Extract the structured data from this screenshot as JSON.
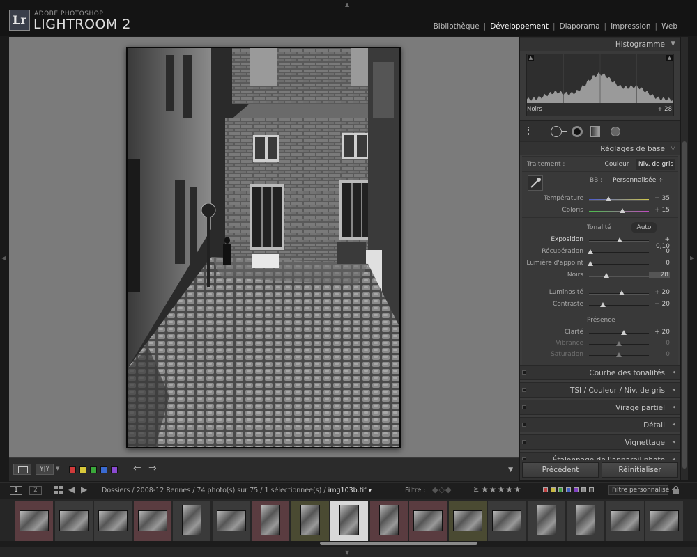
{
  "app": {
    "brand_top": "ADOBE PHOTOSHOP",
    "brand_main": "LIGHTROOM 2",
    "logo_text": "Lr"
  },
  "modules": [
    {
      "label": "Bibliothèque",
      "active": false
    },
    {
      "label": "Développement",
      "active": true
    },
    {
      "label": "Diaporama",
      "active": false
    },
    {
      "label": "Impression",
      "active": false
    },
    {
      "label": "Web",
      "active": false
    }
  ],
  "panels": {
    "histogram": {
      "title": "Histogramme",
      "left_label": "Noirs",
      "right_value": "+ 28"
    },
    "basic": {
      "title": "Réglages de base",
      "treatment_label": "Traitement :",
      "treatment_color": "Couleur",
      "treatment_gray": "Niv. de gris",
      "wb_label": "BB :",
      "wb_value": "Personnalisée ÷",
      "sliders_wb": [
        {
          "label": "Température",
          "value": "− 35",
          "pos": 0.32
        },
        {
          "label": "Coloris",
          "value": "+ 15",
          "pos": 0.56
        }
      ],
      "tone_label": "Tonalité",
      "auto_label": "Auto",
      "sliders_tone": [
        {
          "label": "Exposition",
          "value": "+ 0,10",
          "pos": 0.51,
          "bright": true
        },
        {
          "label": "Récupération",
          "value": "0",
          "pos": 0.0
        },
        {
          "label": "Lumière d'appoint",
          "value": "0",
          "pos": 0.0
        },
        {
          "label": "Noirs",
          "value": "28",
          "pos": 0.28
        }
      ],
      "sliders_tone2": [
        {
          "label": "Luminosité",
          "value": "+ 20",
          "pos": 0.55
        },
        {
          "label": "Contraste",
          "value": "− 20",
          "pos": 0.22
        }
      ],
      "presence_label": "Présence",
      "sliders_presence": [
        {
          "label": "Clarté",
          "value": "+ 20",
          "pos": 0.58,
          "dim": false
        },
        {
          "label": "Vibrance",
          "value": "0",
          "pos": 0.5,
          "dim": true
        },
        {
          "label": "Saturation",
          "value": "0",
          "pos": 0.5,
          "dim": true
        }
      ]
    },
    "collapsed": [
      {
        "title": "Courbe des tonalités"
      },
      {
        "title": "TSI  /  Couleur  /  Niv. de gris"
      },
      {
        "title": "Virage partiel"
      },
      {
        "title": "Détail"
      },
      {
        "title": "Vignettage"
      },
      {
        "title": "Étalonnage de l'appareil photo"
      }
    ],
    "buttons": {
      "previous": "Précédent",
      "reset": "Réinitialiser"
    }
  },
  "toolbar": {
    "yy_label": "Y|Y",
    "color_flags": [
      "#d03a3a",
      "#d8c83a",
      "#3aa83a",
      "#3a6ad0",
      "#8a4ad0"
    ]
  },
  "filmstrip_header": {
    "view1": "1",
    "view2": "2",
    "path": "Dossiers / 2008-12 Rennes / 74 photo(s) sur 75 / 1 sélectionnée(s) / ",
    "filename": "img103b.tif ▾",
    "filter_label": "Filtre :",
    "stars": "★★★★★",
    "filter_flag_colors": [
      "#c04040",
      "#c8b840",
      "#40a040",
      "#4060c0",
      "#8040c0",
      "#888888",
      "#444444"
    ],
    "custom_filter": "Filtre personnalisé ÷"
  },
  "filmstrip": {
    "thumbs": [
      {
        "bg": "#5a3c40",
        "shape": "landscape"
      },
      {
        "bg": "#3a3a3a",
        "shape": "landscape"
      },
      {
        "bg": "#3a3a3a",
        "shape": "landscape"
      },
      {
        "bg": "#5a3c40",
        "shape": "landscape"
      },
      {
        "bg": "#3a3a3a",
        "shape": "portrait"
      },
      {
        "bg": "#3a3a3a",
        "shape": "landscape"
      },
      {
        "bg": "#5a3c40",
        "shape": "portrait"
      },
      {
        "bg": "#4a4a32",
        "shape": "portrait"
      },
      {
        "bg": "#d8d8d8",
        "shape": "portrait",
        "selected": true
      },
      {
        "bg": "#5a3c40",
        "shape": "portrait"
      },
      {
        "bg": "#5a3c40",
        "shape": "landscape"
      },
      {
        "bg": "#4a4a32",
        "shape": "landscape"
      },
      {
        "bg": "#3a3a3a",
        "shape": "landscape"
      },
      {
        "bg": "#3a3a3a",
        "shape": "portrait"
      },
      {
        "bg": "#3a3a3a",
        "shape": "portrait"
      },
      {
        "bg": "#3a3a3a",
        "shape": "landscape"
      },
      {
        "bg": "#3a3a3a",
        "shape": "landscape"
      }
    ]
  }
}
